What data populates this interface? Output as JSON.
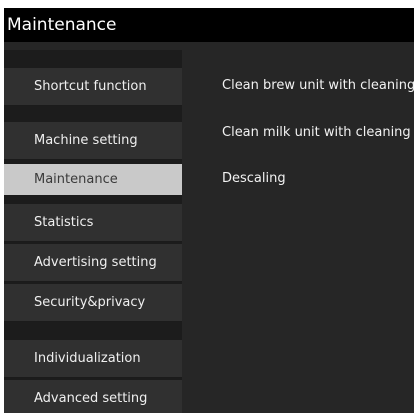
{
  "window": {
    "title": "Maintenance"
  },
  "sidebar": {
    "items": [
      {
        "label": "Shortcut function",
        "selected": false
      },
      {
        "label": "Machine setting",
        "selected": false
      },
      {
        "label": "Maintenance",
        "selected": true
      },
      {
        "label": "Statistics",
        "selected": false
      },
      {
        "label": "Advertising setting",
        "selected": false
      },
      {
        "label": "Security&privacy",
        "selected": false
      },
      {
        "label": "Individualization",
        "selected": false
      },
      {
        "label": "Advanced setting",
        "selected": false
      }
    ]
  },
  "main": {
    "items": [
      {
        "label": "Clean brew unit with cleaning"
      },
      {
        "label": "Clean milk unit with cleaning"
      },
      {
        "label": "Descaling"
      }
    ]
  },
  "colors": {
    "title_bar": "#000000",
    "panel_background": "#262626",
    "sidebar_item": "#303030",
    "selected_item": "#c9c9c9",
    "text": "#efefef"
  }
}
